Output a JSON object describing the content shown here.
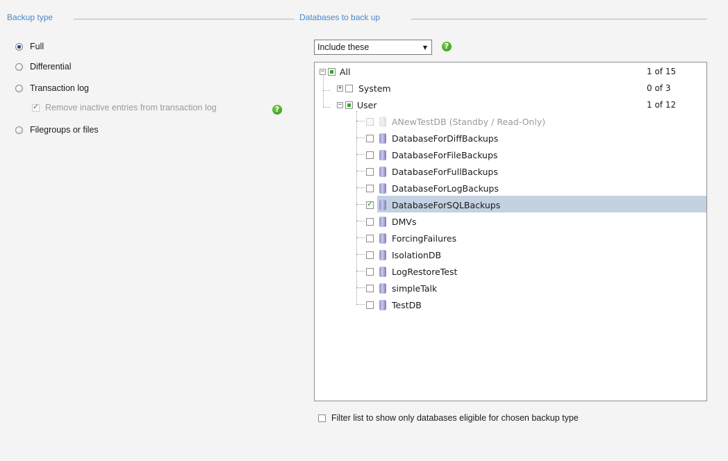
{
  "backup_type": {
    "title": "Backup type",
    "options": [
      {
        "label": "Full",
        "checked": true
      },
      {
        "label": "Differential",
        "checked": false
      },
      {
        "label": "Transaction log",
        "checked": false
      },
      {
        "label": "Filegroups or files",
        "checked": false
      }
    ],
    "remove_inactive_label": "Remove inactive entries from transaction log"
  },
  "databases": {
    "title": "Databases to back up",
    "filter_mode": "Include these",
    "tree": {
      "all": {
        "label": "All",
        "count": "1 of 15"
      },
      "system": {
        "label": "System",
        "count": "0 of 3"
      },
      "user": {
        "label": "User",
        "count": "1 of 12"
      },
      "items": [
        {
          "label": "ANewTestDB (Standby / Read-Only)",
          "checked": false,
          "disabled": true
        },
        {
          "label": "DatabaseForDiffBackups",
          "checked": false
        },
        {
          "label": "DatabaseForFileBackups",
          "checked": false
        },
        {
          "label": "DatabaseForFullBackups",
          "checked": false
        },
        {
          "label": "DatabaseForLogBackups",
          "checked": false
        },
        {
          "label": "DatabaseForSQLBackups",
          "checked": true,
          "selected": true
        },
        {
          "label": "DMVs",
          "checked": false
        },
        {
          "label": "ForcingFailures",
          "checked": false
        },
        {
          "label": "IsolationDB",
          "checked": false
        },
        {
          "label": "LogRestoreTest",
          "checked": false
        },
        {
          "label": "simpleTalk",
          "checked": false
        },
        {
          "label": "TestDB",
          "checked": false
        }
      ]
    },
    "filter_checkbox_label": "Filter list to show only databases eligible for chosen backup type"
  },
  "colors": {
    "group_title": "#4a86c8",
    "selection": "#c3d1e1",
    "help_icon": "#2f8a16"
  }
}
